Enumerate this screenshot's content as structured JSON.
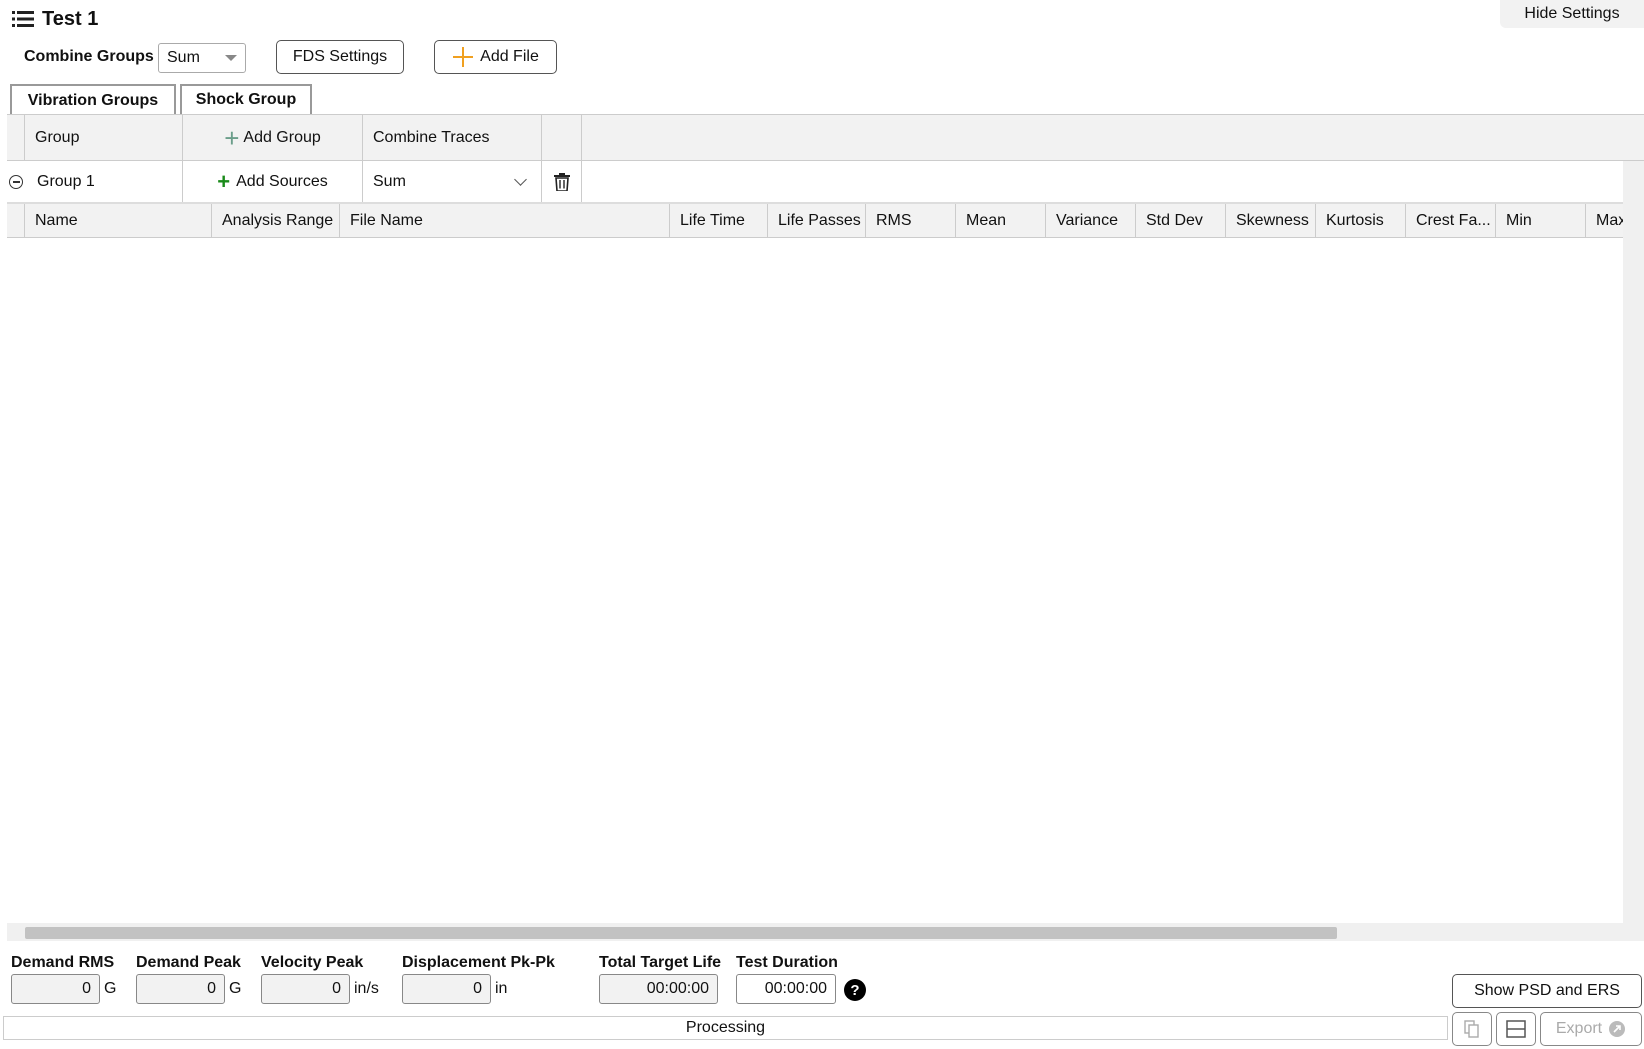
{
  "header": {
    "title": "Test 1",
    "hide_settings_label": "Hide Settings"
  },
  "toolbar": {
    "combine_groups_label": "Combine Groups",
    "combine_groups_value": "Sum",
    "fds_settings_label": "FDS Settings",
    "add_file_label": "Add File"
  },
  "tabs": [
    {
      "label": "Vibration Groups",
      "active": true
    },
    {
      "label": "Shock Group",
      "active": false
    }
  ],
  "group_table": {
    "col_group": "Group",
    "add_group_label": "Add Group",
    "col_combine_traces": "Combine Traces",
    "rows": [
      {
        "name": "Group 1",
        "add_sources_label": "Add Sources",
        "combine_value": "Sum"
      }
    ]
  },
  "source_table": {
    "columns": [
      "Name",
      "Analysis Range",
      "File Name",
      "Life Time",
      "Life Passes",
      "RMS",
      "Mean",
      "Variance",
      "Std Dev",
      "Skewness",
      "Kurtosis",
      "Crest Fa...",
      "Min",
      "Max"
    ]
  },
  "summary": {
    "demand_rms": {
      "label": "Demand RMS",
      "value": "0",
      "unit": "G"
    },
    "demand_peak": {
      "label": "Demand Peak",
      "value": "0",
      "unit": "G"
    },
    "velocity_peak": {
      "label": "Velocity Peak",
      "value": "0",
      "unit": "in/s"
    },
    "displacement": {
      "label": "Displacement Pk-Pk",
      "value": "0",
      "unit": "in"
    },
    "total_target_life": {
      "label": "Total Target Life",
      "value": "00:00:00"
    },
    "test_duration": {
      "label": "Test Duration",
      "value": "00:00:00"
    },
    "help_glyph": "?",
    "show_psd_label": "Show PSD and ERS"
  },
  "status_bar": {
    "status_text": "Processing",
    "export_label": "Export"
  },
  "colors": {
    "add_file_icon": "#f0a020",
    "add_group_icon": "#6b9e8a",
    "add_sources_icon": "#1a8a1a",
    "header_bg": "#f2f2f2"
  }
}
